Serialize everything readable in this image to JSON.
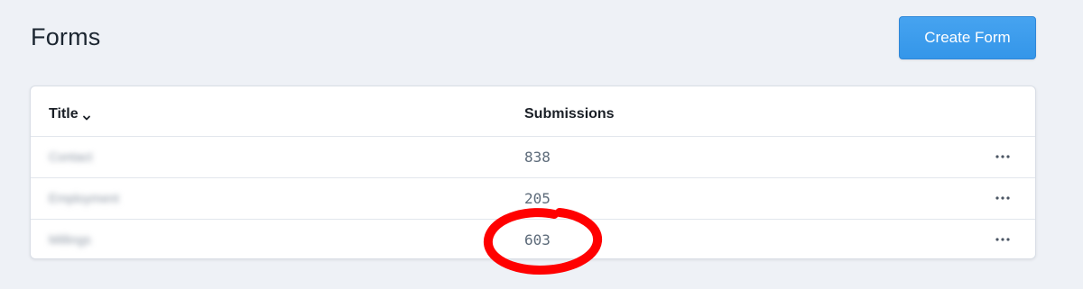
{
  "header": {
    "title": "Forms",
    "create_button_label": "Create Form"
  },
  "table": {
    "columns": [
      {
        "label": "Title",
        "sortable": true,
        "sort_icon": "chevron-down-icon"
      },
      {
        "label": "Submissions"
      }
    ],
    "rows": [
      {
        "title": "Contact",
        "submissions": "838",
        "actions_icon": "more-horizontal-icon"
      },
      {
        "title": "Employment",
        "submissions": "205",
        "actions_icon": "more-horizontal-icon"
      },
      {
        "title": "Millings",
        "submissions": "603",
        "actions_icon": "more-horizontal-icon"
      }
    ]
  },
  "annotation": {
    "shape": "hand-drawn-circle",
    "color": "#ff0000",
    "target": "table.rows.2.submissions"
  },
  "colors": {
    "background": "#eef1f6",
    "primary_button": "#3a9bec",
    "card": "#ffffff"
  }
}
